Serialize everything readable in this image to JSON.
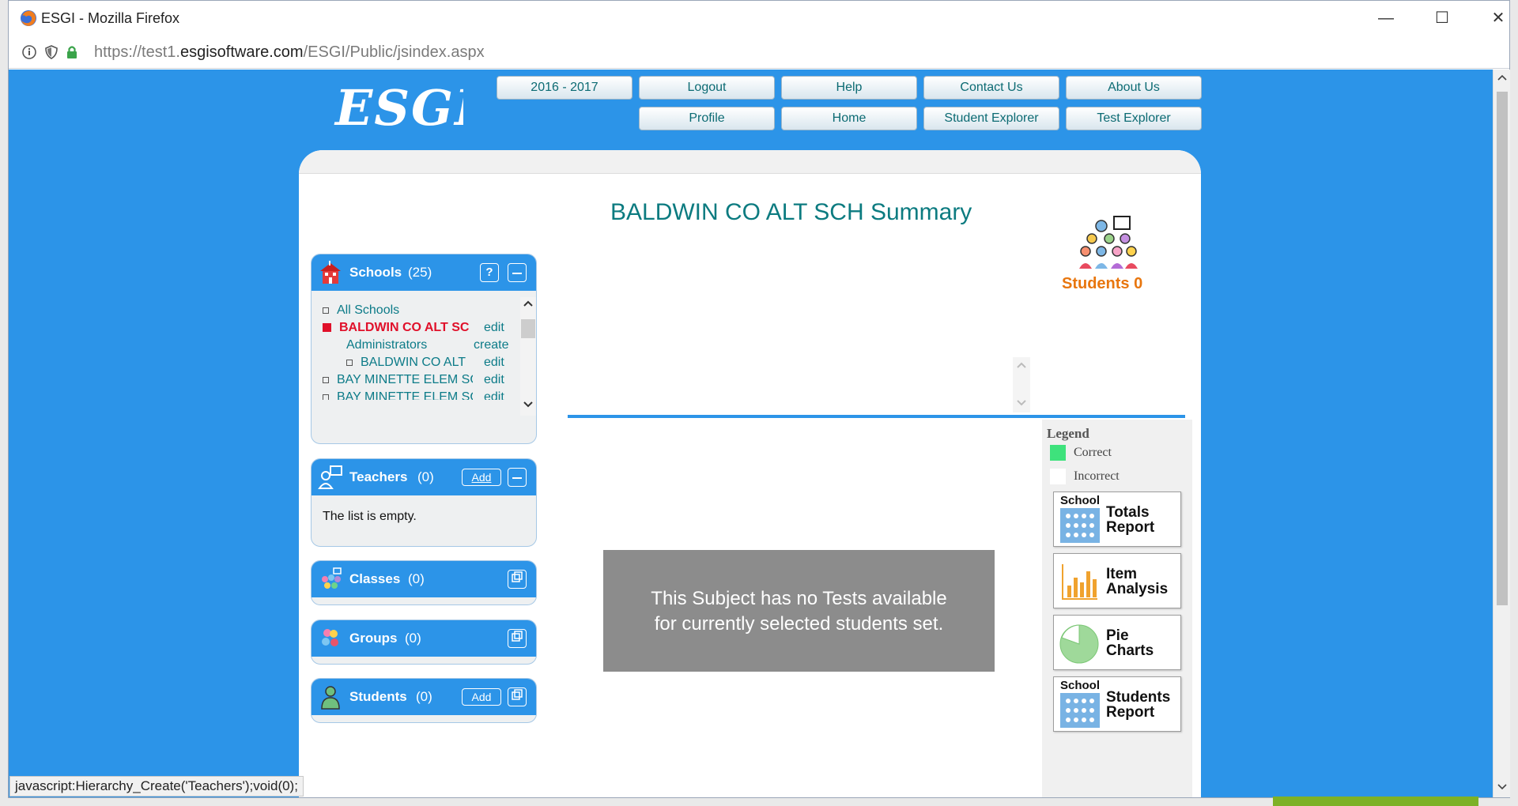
{
  "browser": {
    "window_title": "ESGI - Mozilla Firefox",
    "url_prefix": "https://test1.",
    "url_domain": "esgisoftware.com",
    "url_path": "/ESGI/Public/jsindex.aspx"
  },
  "header": {
    "logo_text": "ESGI",
    "nav_row1": [
      "2016 - 2017",
      "Logout",
      "Help",
      "Contact Us",
      "About Us"
    ],
    "nav_row2": [
      "Profile",
      "Home",
      "Student Explorer",
      "Test Explorer"
    ]
  },
  "sidebar": {
    "schools": {
      "title": "Schools",
      "count": "(25)",
      "help_label": "?",
      "items": [
        {
          "label": "All Schools",
          "action": ""
        },
        {
          "label": "BALDWIN CO ALT SC",
          "action": "edit"
        },
        {
          "label": "Administrators",
          "action": "create"
        },
        {
          "label": "BALDWIN CO ALT",
          "action": "edit"
        },
        {
          "label": "BAY MINETTE ELEM SC",
          "action": "edit"
        },
        {
          "label": "BAY MINETTE ELEM SC",
          "action": "edit"
        }
      ]
    },
    "teachers": {
      "title": "Teachers",
      "count": "(0)",
      "add_label": "Add",
      "empty_text": "The list is empty."
    },
    "classes": {
      "title": "Classes",
      "count": "(0)"
    },
    "groups": {
      "title": "Groups",
      "count": "(0)"
    },
    "students": {
      "title": "Students",
      "count": "(0)",
      "add_label": "Add"
    }
  },
  "main": {
    "summary_title": "BALDWIN CO ALT SCH Summary",
    "students_count_label": "Students 0",
    "no_tests_line1": "This Subject has no Tests available",
    "no_tests_line2": "for currently selected students set."
  },
  "legend": {
    "title": "Legend",
    "correct_label": "Correct",
    "incorrect_label": "Incorrect",
    "correct_color": "#3ee27c",
    "incorrect_color": "#ffffff"
  },
  "reports": [
    {
      "small": "School",
      "line1": "Totals",
      "line2": "Report",
      "icon": "grid-icon"
    },
    {
      "small": "",
      "line1": "Item",
      "line2": "Analysis",
      "icon": "bar-chart-icon"
    },
    {
      "small": "",
      "line1": "Pie",
      "line2": "Charts",
      "icon": "pie-chart-icon"
    },
    {
      "small": "School",
      "line1": "Students",
      "line2": "Report",
      "icon": "grid-icon"
    }
  ],
  "status_bar": "javascript:Hierarchy_Create('Teachers');void(0);"
}
